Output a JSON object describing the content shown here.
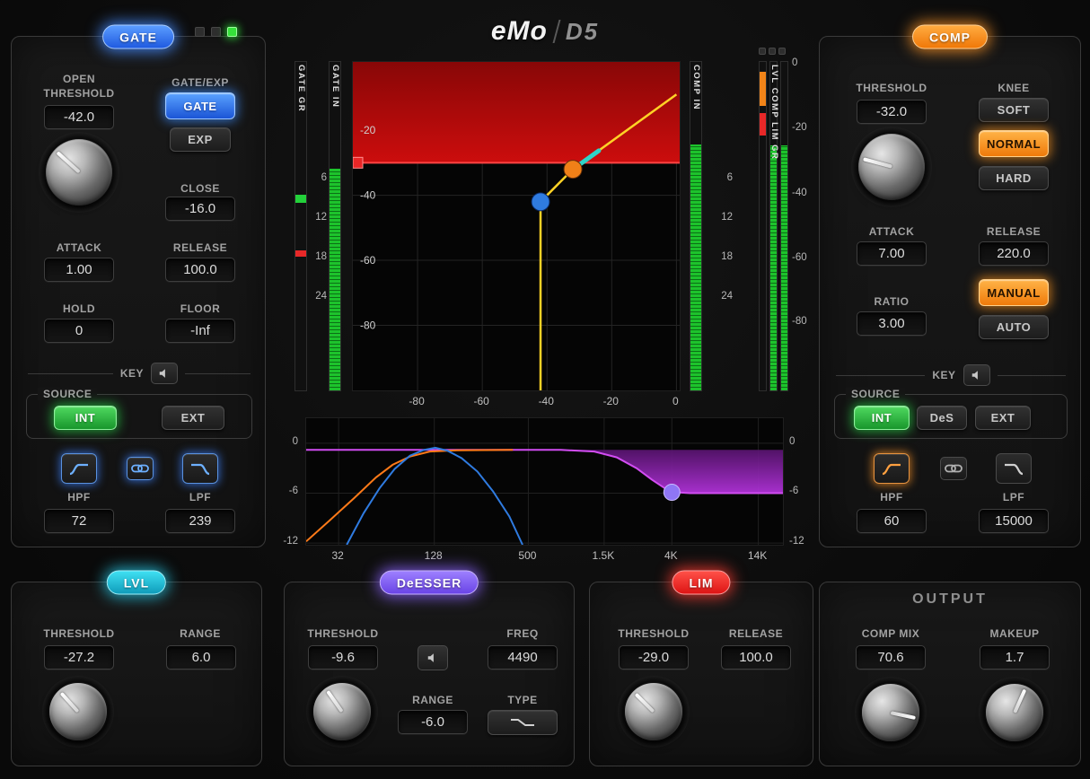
{
  "logo": {
    "brand": "eMo",
    "model": "D5"
  },
  "gate": {
    "title": "GATE",
    "open_line1": "OPEN",
    "open_line2": "THRESHOLD",
    "open_value": "-42.0",
    "mode_label": "GATE/EXP",
    "mode_gate": "GATE",
    "mode_exp": "EXP",
    "close_label": "CLOSE",
    "close_value": "-16.0",
    "attack_label": "ATTACK",
    "attack_value": "1.00",
    "release_label": "RELEASE",
    "release_value": "100.0",
    "hold_label": "HOLD",
    "hold_value": "0",
    "floor_label": "FLOOR",
    "floor_value": "-Inf",
    "key_label": "KEY",
    "source_label": "SOURCE",
    "source_int": "INT",
    "source_ext": "EXT",
    "hpf_label": "HPF",
    "hpf_value": "72",
    "lpf_label": "LPF",
    "lpf_value": "239"
  },
  "comp": {
    "title": "COMP",
    "threshold_label": "THRESHOLD",
    "threshold_value": "-32.0",
    "knee_label": "KNEE",
    "knee_soft": "SOFT",
    "knee_normal": "NORMAL",
    "knee_hard": "HARD",
    "attack_label": "ATTACK",
    "attack_value": "7.00",
    "release_label": "RELEASE",
    "release_value": "220.0",
    "ratio_label": "RATIO",
    "ratio_value": "3.00",
    "release_manual": "MANUAL",
    "release_auto": "AUTO",
    "key_label": "KEY",
    "source_label": "SOURCE",
    "source_int": "INT",
    "source_des": "DeS",
    "source_ext": "EXT",
    "hpf_label": "HPF",
    "hpf_value": "60",
    "lpf_label": "LPF",
    "lpf_value": "15000"
  },
  "lvl": {
    "title": "LVL",
    "threshold_label": "THRESHOLD",
    "threshold_value": "-27.2",
    "range_label": "RANGE",
    "range_value": "6.0"
  },
  "deesser": {
    "title": "DeESSER",
    "threshold_label": "THRESHOLD",
    "threshold_value": "-9.6",
    "freq_label": "FREQ",
    "freq_value": "4490",
    "range_label": "RANGE",
    "range_value": "-6.0",
    "type_label": "TYPE"
  },
  "lim": {
    "title": "LIM",
    "threshold_label": "THRESHOLD",
    "threshold_value": "-29.0",
    "release_label": "RELEASE",
    "release_value": "100.0"
  },
  "output": {
    "title": "OUTPUT",
    "comp_mix_label": "COMP MIX",
    "comp_mix_value": "70.6",
    "makeup_label": "MAKEUP",
    "makeup_value": "1.7"
  },
  "meters": {
    "gate_gr": {
      "label": "GATE GR",
      "marks": [
        {
          "color": "green",
          "from": 0.405,
          "to": 0.43
        },
        {
          "color": "red",
          "from": 0.575,
          "to": 0.592
        }
      ]
    },
    "gate_in": {
      "label": "GATE IN",
      "fill": 0.675
    },
    "comp_in": {
      "label": "COMP IN",
      "fill": 0.75
    },
    "trio_label": "LVL COMP LIM GR",
    "lvl_gr": {
      "marks": [
        {
          "color": "orange",
          "from": 0.03,
          "to": 0.135
        },
        {
          "color": "red",
          "from": 0.155,
          "to": 0.225
        }
      ]
    },
    "comp_gr": {
      "fill": 0.745
    },
    "lim_gr": {
      "fill": 0.745
    },
    "scale_left": [
      "6",
      "12",
      "18",
      "24"
    ],
    "scale_right": [
      "6",
      "12",
      "18",
      "24"
    ],
    "scale_far_right": [
      "0",
      "-20",
      "-40",
      "-60",
      "-80"
    ]
  },
  "colors": {
    "gate_blue": "#2f7ce0",
    "comp_orange": "#f08018",
    "lvl_cyan": "#1ec8e0",
    "deesser_purple": "#8468f0",
    "lim_red": "#e82020",
    "int_green": "#2fb844",
    "curve_yellow": "#ffd226",
    "knee_teal": "#2fd4c8",
    "deesser_line": "#d24df2",
    "red_zone_top": "#880707",
    "red_zone_bottom": "#cc0d0d",
    "meter_green": "#23d13a",
    "meter_red": "#e82828",
    "meter_orange": "#f28418"
  },
  "chart_data": [
    {
      "type": "line",
      "name": "dynamics-transfer",
      "xlabel": "input dB",
      "ylabel": "output dB",
      "xlim": [
        -100,
        1
      ],
      "ylim": [
        -100,
        1
      ],
      "x_tick_labels": [
        "-80",
        "-60",
        "-40",
        "-20",
        "0"
      ],
      "x_tick_values": [
        -80,
        -60,
        -40,
        -20,
        0
      ],
      "y_tick_labels": [
        "-20",
        "-40",
        "-60",
        "-80"
      ],
      "y_tick_values": [
        -20,
        -40,
        -60,
        -80
      ],
      "limit_zone": {
        "from_db": -30,
        "to_db": 1
      },
      "curve": [
        [
          -42,
          -100
        ],
        [
          -42,
          -42
        ],
        [
          -32,
          -32
        ],
        [
          0,
          -9
        ]
      ],
      "knee_segment": [
        [
          -30,
          -30.6
        ],
        [
          -24,
          -26.3
        ]
      ],
      "gate_handle": [
        -42,
        -42
      ],
      "comp_handle": [
        -32,
        -32
      ],
      "limit_handle_db": -30
    },
    {
      "type": "line",
      "name": "sidechain-eq",
      "xlabel": "frequency Hz",
      "ylabel": "gain dB",
      "xlim_hz": [
        20,
        20000
      ],
      "ylim_db": [
        3,
        -12.2
      ],
      "x_tick_labels": [
        "32",
        "128",
        "500",
        "1.5K",
        "4K",
        "14K"
      ],
      "x_tick_values": [
        32,
        128,
        500,
        1500,
        4000,
        14000
      ],
      "y_tick_labels": [
        "0",
        "-6",
        "-12"
      ],
      "y_tick_values": [
        0,
        -6,
        -12
      ],
      "deesser_curve": [
        [
          20,
          -0.8
        ],
        [
          800,
          -0.8
        ],
        [
          1300,
          -1.0
        ],
        [
          1800,
          -1.7
        ],
        [
          2400,
          -3.0
        ],
        [
          3000,
          -4.4
        ],
        [
          3600,
          -5.4
        ],
        [
          4300,
          -5.9
        ],
        [
          5200,
          -6
        ],
        [
          20000,
          -6
        ]
      ],
      "comp_hpf_curve": [
        [
          20,
          -11.8
        ],
        [
          28,
          -9.3
        ],
        [
          40,
          -6.6
        ],
        [
          55,
          -4.1
        ],
        [
          70,
          -2.6
        ],
        [
          90,
          -1.6
        ],
        [
          120,
          -1.0
        ],
        [
          180,
          -0.85
        ],
        [
          400,
          -0.8
        ]
      ],
      "gate_band_curve": [
        [
          36,
          -12.2
        ],
        [
          46,
          -8.4
        ],
        [
          58,
          -5.4
        ],
        [
          72,
          -3.1
        ],
        [
          90,
          -1.5
        ],
        [
          110,
          -0.8
        ],
        [
          130,
          -0.55
        ],
        [
          155,
          -0.9
        ],
        [
          190,
          -1.8
        ],
        [
          239,
          -3.4
        ],
        [
          300,
          -5.8
        ],
        [
          380,
          -8.8
        ],
        [
          460,
          -12.2
        ]
      ],
      "deesser_handle": [
        4000,
        -5.9
      ]
    }
  ]
}
